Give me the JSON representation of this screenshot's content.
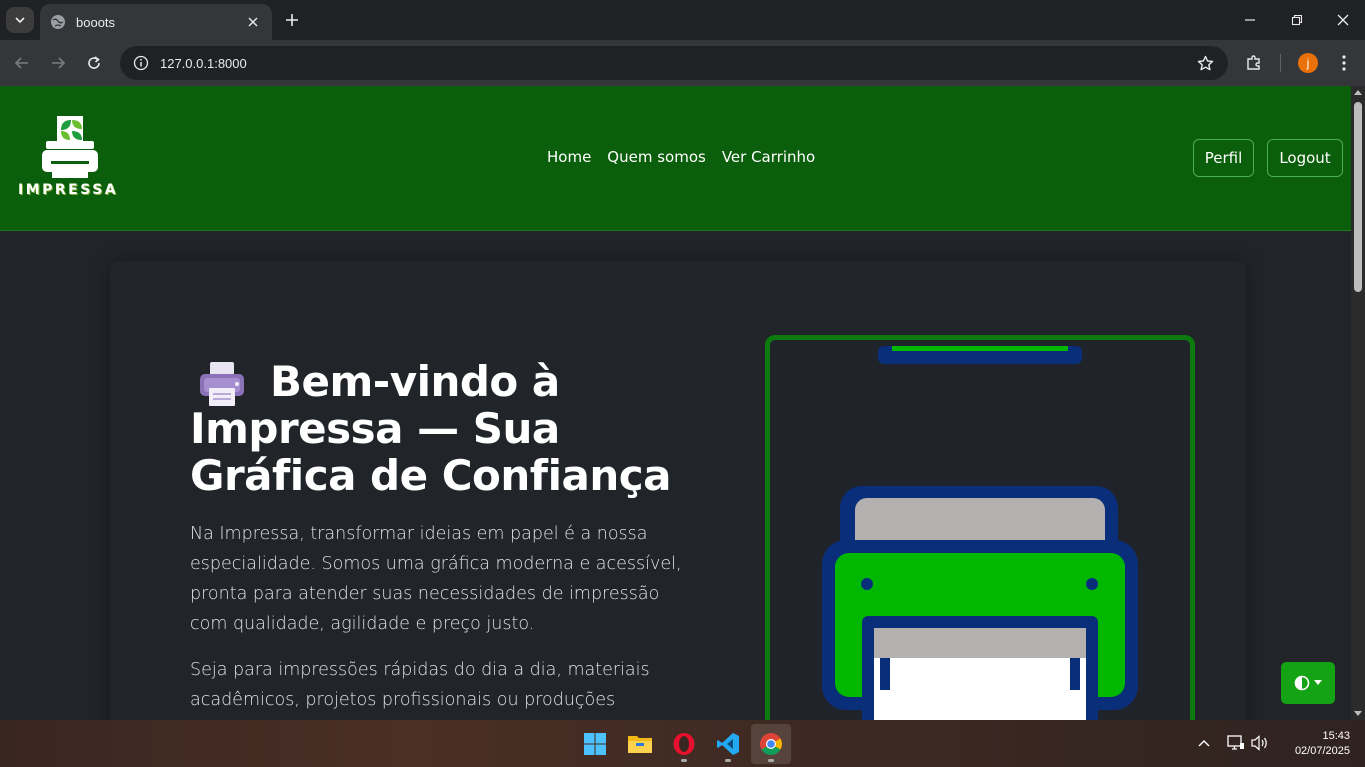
{
  "browser": {
    "tab_title": "booots",
    "url": "127.0.0.1:8000",
    "profile_initial": "j"
  },
  "site": {
    "logo_text": "IMPRESSA",
    "nav": [
      "Home",
      "Quem somos",
      "Ver Carrinho"
    ],
    "perfil_label": "Perfil",
    "logout_label": "Logout"
  },
  "hero": {
    "title": "Bem-vindo à Impressa — Sua Gráfica de Confiança",
    "p1": "Na Impressa, transformar ideias em papel é a nossa especialidade. Somos uma gráfica moderna e acessível, pronta para atender suas necessidades de impressão com qualidade, agilidade e preço justo.",
    "p2": "Seja para impressões rápidas do dia a dia, materiais acadêmicos, projetos profissionais ou produções"
  },
  "colors": {
    "header_bg": "#0b5e0b",
    "printer_green": "#00b800",
    "printer_blue": "#0a2f7a",
    "theme_button": "#14a314"
  },
  "taskbar": {
    "time": "15:43",
    "date": "02/07/2025",
    "apps": [
      "windows-start-icon",
      "file-explorer-icon",
      "opera-icon",
      "vscode-icon",
      "chrome-icon"
    ]
  }
}
